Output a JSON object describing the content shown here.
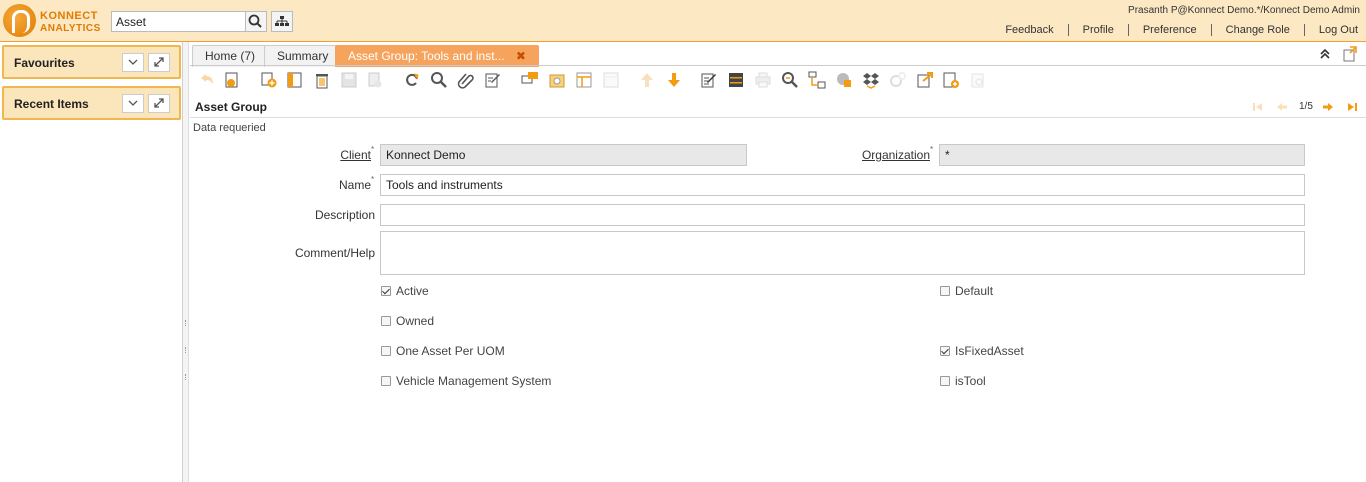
{
  "brand": {
    "line1": "KONNECT",
    "line2": "ANALYTICS",
    "accent": "#f39c12"
  },
  "search": {
    "value": "Asset"
  },
  "user": {
    "info": "Prasanth P@Konnect Demo.*/Konnect Demo Admin"
  },
  "top_links": [
    "Feedback",
    "Profile",
    "Preference",
    "Change Role",
    "Log Out"
  ],
  "left_panel": {
    "favourites": "Favourites",
    "recent_items": "Recent Items"
  },
  "tabs": [
    {
      "label": "Home (7)"
    },
    {
      "label": "Summary"
    },
    {
      "label": "Asset Group: Tools and inst..."
    }
  ],
  "window": {
    "title": "Asset Group",
    "pager": "1/5",
    "status": "Data requeried"
  },
  "form": {
    "client_label": "Client",
    "client_value": "Konnect Demo",
    "org_label": "Organization",
    "org_value": "*",
    "name_label": "Name",
    "name_value": "Tools and instruments",
    "description_label": "Description",
    "description_value": "",
    "comment_label": "Comment/Help",
    "comment_value": "",
    "checkboxes": [
      {
        "label": "Active",
        "checked": true
      },
      {
        "label": "Default",
        "checked": false
      },
      {
        "label": "Owned",
        "checked": false
      },
      {
        "label": "One Asset Per UOM",
        "checked": false
      },
      {
        "label": "IsFixedAsset",
        "checked": true
      },
      {
        "label": "Vehicle Management System",
        "checked": false
      },
      {
        "label": "isTool",
        "checked": false
      }
    ]
  }
}
